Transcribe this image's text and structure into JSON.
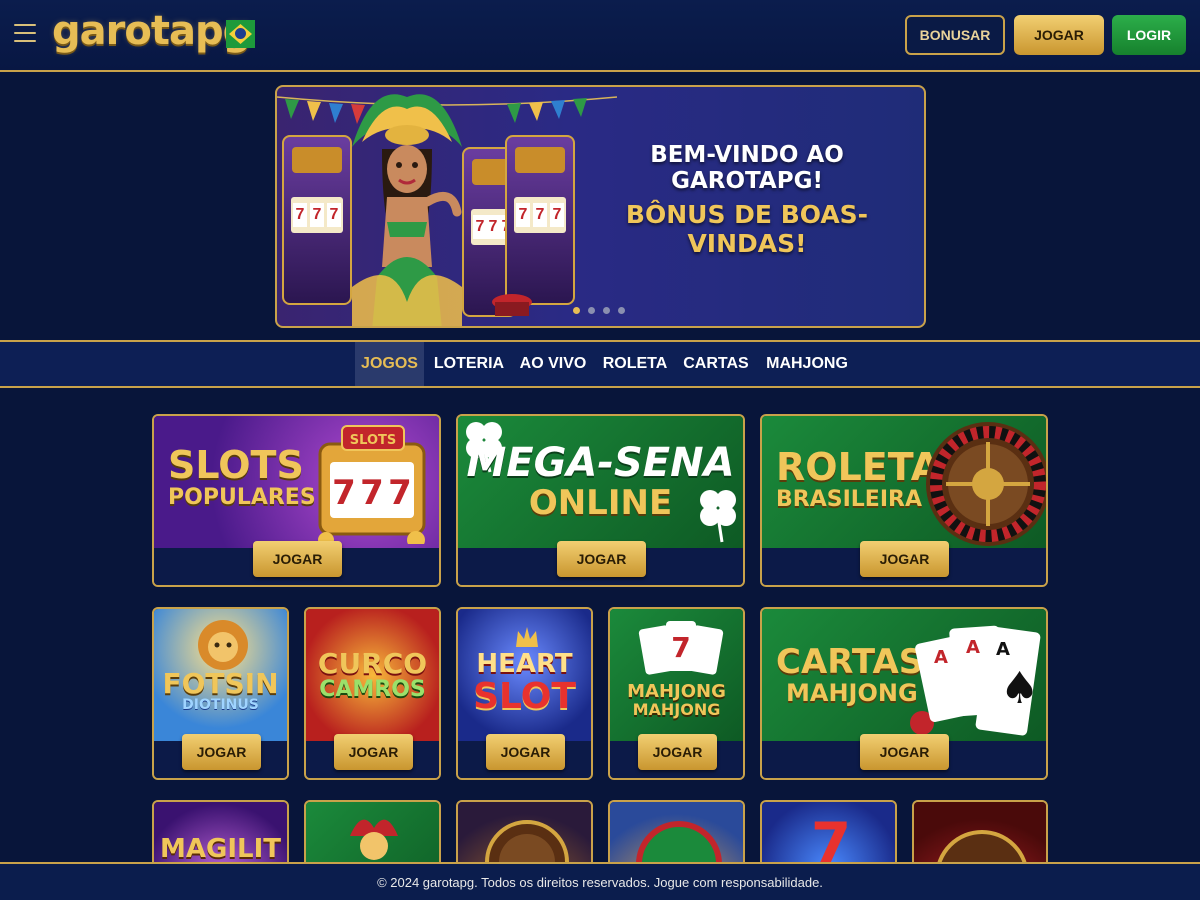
{
  "header": {
    "logo": "garotapg",
    "buttons": {
      "bonusar": "BONUSAR",
      "jogar": "JOGAR",
      "login": "LOGIR"
    }
  },
  "banner": {
    "line1": "BEM-VINDO AO GAROTAPG!",
    "line2": "BÔNUS DE BOAS-VINDAS!",
    "slide_count": 4,
    "active_slide": 1
  },
  "nav": {
    "tabs": [
      "JOGOS",
      "LOTERIA",
      "AO VIVO",
      "ROLETA",
      "CARTAS",
      "MAHJONG"
    ],
    "active": "JOGOS"
  },
  "featured": [
    {
      "title1": "SLOTS",
      "title2": "POPULARES",
      "icon": "slot-machine-icon",
      "button": "JOGAR"
    },
    {
      "title1": "MEGA-SENA",
      "title2": "ONLINE",
      "icon": "clover-icon",
      "button": "JOGAR"
    },
    {
      "title1": "ROLETA",
      "title2": "BRASILEIRA",
      "icon": "roulette-wheel-icon",
      "button": "JOGAR"
    }
  ],
  "games_row2": [
    {
      "title1": "FOTSIN",
      "title2": "DIOTINUS",
      "button": "JOGAR"
    },
    {
      "title1": "CURCO",
      "title2": "CAMROS",
      "button": "JOGAR"
    },
    {
      "title1": "HEART",
      "title2": "SLOT",
      "button": "JOGAR"
    },
    {
      "title1": "MAHJONG",
      "title2": "MAHJONG",
      "button": "JOGAR"
    }
  ],
  "cartas_card": {
    "title1": "CARTAS",
    "title2": "MAHJONG",
    "icon": "playing-cards-icon",
    "button": "JOGAR"
  },
  "games_row3": [
    {
      "title": "MAGILIT"
    },
    {
      "title": ""
    },
    {
      "title": ""
    },
    {
      "title": ""
    },
    {
      "title": ""
    },
    {
      "title": ""
    }
  ],
  "footer": {
    "text": "© 2024 garotapg. Todos os direitos reservados. Jogue com responsabilidade."
  },
  "colors": {
    "gold": "#c9a24a",
    "navy": "#08153a",
    "green": "#16812d"
  }
}
